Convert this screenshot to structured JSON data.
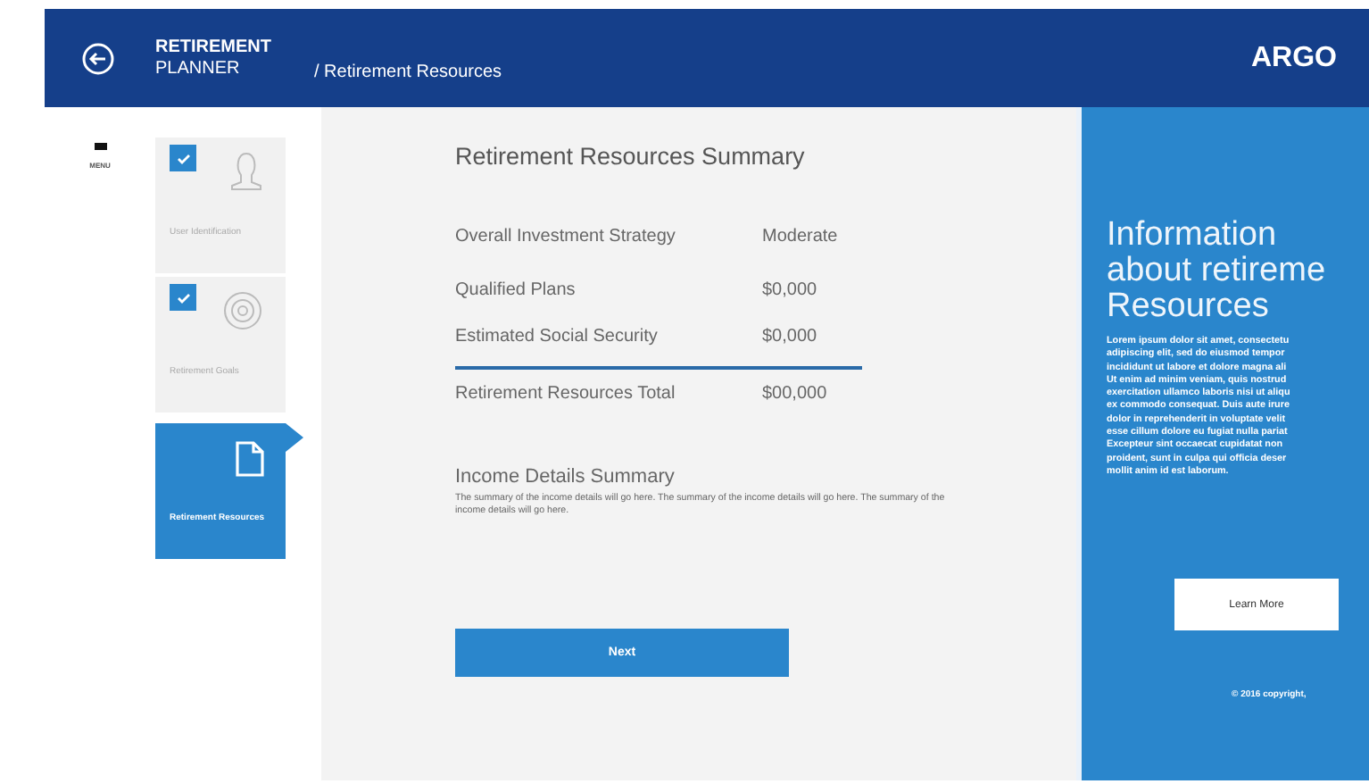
{
  "header": {
    "title_line1": "RETIREMENT",
    "title_line2": "PLANNER",
    "breadcrumb": "/ Retirement Resources",
    "logo": "ARGO"
  },
  "menu": {
    "label": "MENU"
  },
  "steps": [
    {
      "label": "User Identification",
      "kind": "person",
      "checked": true,
      "selected": false
    },
    {
      "label": "Retirement Goals",
      "kind": "target",
      "checked": true,
      "selected": false
    },
    {
      "label": "Retirement Resources",
      "kind": "document",
      "checked": false,
      "selected": true
    }
  ],
  "summary": {
    "title": "Retirement Resources Summary",
    "rows": [
      {
        "label": "Overall Investment Strategy",
        "value": "Moderate",
        "kind": "strategy"
      },
      {
        "label": "Qualified Plans",
        "value": "$0,000",
        "kind": "item"
      },
      {
        "label": "Estimated Social Security",
        "value": "$0,000",
        "kind": "item"
      },
      {
        "label": "Retirement Resources Total",
        "value": "$00,000",
        "kind": "total"
      }
    ],
    "income_title": "Income Details Summary",
    "income_text": "The summary of the income details will go here. The summary of the income details will go here. The summary of the income details will go here.",
    "next": "Next"
  },
  "info": {
    "title_lines": [
      "Information",
      "about retireme",
      "Resources"
    ],
    "body_lines": [
      "Lorem ipsum dolor sit amet, consectetu",
      "adipiscing elit, sed do eiusmod tempor",
      "incididunt ut labore et dolore magna ali",
      "Ut enim ad minim veniam, quis nostrud",
      "exercitation ullamco laboris nisi ut aliqu",
      "ex commodo consequat. Duis aute irure",
      "dolor in reprehenderit in voluptate velit",
      "esse cillum dolore eu fugiat nulla pariat",
      "Excepteur sint occaecat cupidatat non",
      "proident, sunt in culpa qui officia deser",
      "mollit anim id est laborum."
    ],
    "button": "Learn More",
    "copyright": "© 2016 copyright,"
  }
}
